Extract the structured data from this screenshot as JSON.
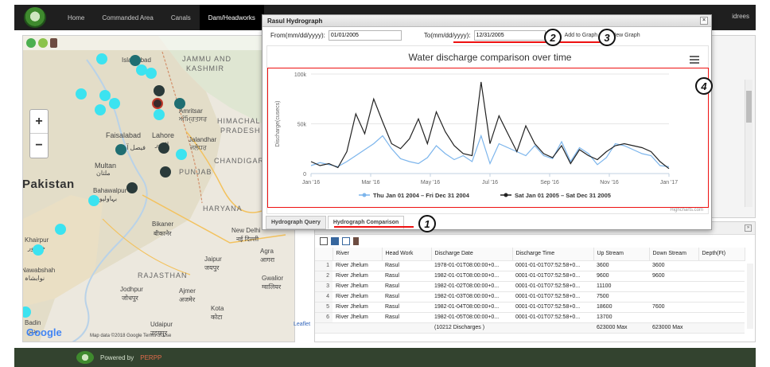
{
  "nav": {
    "items": [
      {
        "label": "Home",
        "active": false
      },
      {
        "label": "Commanded Area",
        "active": false
      },
      {
        "label": "Canals",
        "active": false
      },
      {
        "label": "Dam/Headworks",
        "active": true
      }
    ],
    "user": "idrees"
  },
  "map": {
    "zoom_in": "+",
    "zoom_out": "−",
    "labels": {
      "islamabad": "Islamabad",
      "jammu": "JAMMU AND",
      "kashmir": "KASHMIR",
      "amritsar": "Amritsar",
      "amritsar_local": "ਅੰਮ੍ਰਿਤਸਰ",
      "himachal1": "HIMACHAL",
      "himachal2": "PRADESH",
      "faisalabad": "Faisalabad",
      "faisalabad_local": "فیصل آباد",
      "lahore": "Lahore",
      "lahore_local": "لاہور",
      "jalandhar": "Jalandhar",
      "jalandhar_local": "ਜਲੰਧਰ",
      "multan": "Multan",
      "multan_local": "ملتان",
      "punjab": "PUNJAB",
      "chandigarh": "CHANDIGAR",
      "pakistan": "Pakistan",
      "bahawalpur": "Bahawalpur",
      "bahawalpur_local": "بہاولپور",
      "haryana": "HARYANA",
      "bikaner": "Bikaner",
      "bikaner_local": "बीकानेर",
      "newdelhi": "New Delhi",
      "newdelhi_local": "नई दिल्ली",
      "khairpur": "Khairpur",
      "khairpur_local": "خیرپور",
      "agra": "Agra",
      "agra_local": "आगरा",
      "jaipur": "Jaipur",
      "jaipur_local": "जयपुर",
      "nawabshah": "Nawabshah",
      "nawabshah_local": "نوابشاہ",
      "rajasthan": "RAJASTHAN",
      "gwalior": "Gwalior",
      "gwalior_local": "ग्वालियर",
      "jodhpur": "Jodhpur",
      "jodhpur_local": "जोधपुर",
      "ajmer": "Ajmer",
      "ajmer_local": "अजमेर",
      "kota": "Kota",
      "kota_local": "कोटा",
      "badin": "Badin",
      "badin_local": "بدین",
      "udaipur": "Udaipur",
      "udaipur_local": "उदयपुर"
    },
    "google": "Google",
    "footer": "Map data ©2018 Google   Terms of Use",
    "leaflet": "Leaflet"
  },
  "dialog": {
    "title": "Rasul Hydrograph",
    "close": "×",
    "from_label": "From(mm/dd/yyyy):",
    "from_value": "01/01/2005",
    "to_label": "To(mm/dd/yyyy):",
    "to_value": "12/31/2005",
    "add_to_graph": "Add to Graph",
    "new_graph": "New Graph",
    "tabs": [
      {
        "label": "Hydrograph Query",
        "active": false
      },
      {
        "label": "Hydrograph Comparison",
        "active": true
      }
    ],
    "callouts": [
      "1",
      "2",
      "3",
      "4"
    ]
  },
  "chart_data": {
    "type": "line",
    "title": "Water discharge comparison over time",
    "ylabel": "Discharge(cusecs)",
    "xlabel": "",
    "credit": "Highcharts.com",
    "y_ticks": [
      {
        "value": 0,
        "label": "0"
      },
      {
        "value": 50000,
        "label": "50k"
      },
      {
        "value": 100000,
        "label": "100k"
      }
    ],
    "x_ticks": [
      "Jan '16",
      "Mar '16",
      "May '16",
      "Jul '16",
      "Sep '16",
      "Nov '16",
      "Jan '17"
    ],
    "ylim": [
      0,
      100000
    ],
    "xlim": [
      0,
      12
    ],
    "grid": true,
    "legend_position": "bottom",
    "series": [
      {
        "name": "Thu Jan 01 2004 – Fri Dec 31 2004",
        "color": "#7cb5ec",
        "x": [
          0,
          0.3,
          0.6,
          0.9,
          1.2,
          1.5,
          1.8,
          2.1,
          2.4,
          2.7,
          3.0,
          3.3,
          3.6,
          3.9,
          4.2,
          4.5,
          4.8,
          5.1,
          5.4,
          5.7,
          6.0,
          6.3,
          6.6,
          6.9,
          7.2,
          7.5,
          7.8,
          8.1,
          8.4,
          8.7,
          9.0,
          9.3,
          9.6,
          9.9,
          10.2,
          10.5,
          10.8,
          11.1,
          11.4,
          11.7,
          12.0
        ],
        "y": [
          8000,
          11000,
          9000,
          7000,
          12000,
          18000,
          24000,
          30000,
          38000,
          25000,
          15000,
          12000,
          10000,
          16000,
          28000,
          20000,
          14000,
          18000,
          12000,
          38000,
          10000,
          30000,
          26000,
          22000,
          18000,
          28000,
          18000,
          15000,
          32000,
          12000,
          26000,
          20000,
          9000,
          16000,
          30000,
          28000,
          24000,
          20000,
          18000,
          8000,
          7000
        ]
      },
      {
        "name": "Sat Jan 01 2005 – Sat Dec 31 2005",
        "color": "#222222",
        "x": [
          0,
          0.3,
          0.6,
          0.9,
          1.2,
          1.5,
          1.8,
          2.1,
          2.4,
          2.7,
          3.0,
          3.3,
          3.6,
          3.9,
          4.2,
          4.5,
          4.8,
          5.1,
          5.4,
          5.7,
          6.0,
          6.3,
          6.6,
          6.9,
          7.2,
          7.5,
          7.8,
          8.1,
          8.4,
          8.7,
          9.0,
          9.3,
          9.6,
          9.9,
          10.2,
          10.5,
          10.8,
          11.1,
          11.4,
          11.7,
          12.0
        ],
        "y": [
          12000,
          8000,
          10000,
          6000,
          22000,
          60000,
          40000,
          75000,
          52000,
          30000,
          25000,
          35000,
          55000,
          30000,
          62000,
          42000,
          28000,
          20000,
          18000,
          92000,
          30000,
          58000,
          40000,
          22000,
          48000,
          30000,
          20000,
          16000,
          28000,
          10000,
          24000,
          18000,
          14000,
          22000,
          28000,
          30000,
          28000,
          26000,
          22000,
          12000,
          5000
        ]
      }
    ]
  },
  "table": {
    "columns": [
      "",
      "River",
      "Head Work",
      "Discharge Date",
      "Discharge Time",
      "Up Stream",
      "Down Stream",
      "Depth(Ft)"
    ],
    "rows": [
      [
        "1",
        "River Jhelum",
        "Rasul",
        "1978-01-01T08:00:00+0...",
        "0001-01-01T07:52:58+0...",
        "3600",
        "3600",
        ""
      ],
      [
        "2",
        "River Jhelum",
        "Rasul",
        "1982-01-01T08:00:00+0...",
        "0001-01-01T07:52:58+0...",
        "9600",
        "9600",
        ""
      ],
      [
        "3",
        "River Jhelum",
        "Rasul",
        "1982-01-02T08:00:00+0...",
        "0001-01-01T07:52:58+0...",
        "11100",
        "",
        ""
      ],
      [
        "4",
        "River Jhelum",
        "Rasul",
        "1982-01-03T08:00:00+0...",
        "0001-01-01T07:52:58+0...",
        "7500",
        "",
        ""
      ],
      [
        "5",
        "River Jhelum",
        "Rasul",
        "1982-01-04T08:00:00+0...",
        "0001-01-01T07:52:58+0...",
        "18600",
        "7600",
        ""
      ],
      [
        "6",
        "River Jhelum",
        "Rasul",
        "1982-01-05T08:00:00+0...",
        "0001-01-01T07:52:58+0...",
        "13700",
        "",
        ""
      ]
    ],
    "footer": [
      "",
      "",
      "",
      "(10212 Discharges )",
      "",
      "623000 Max",
      "623000 Max",
      ""
    ]
  },
  "footer": {
    "powered": "Powered by",
    "brand": "PERPP"
  }
}
